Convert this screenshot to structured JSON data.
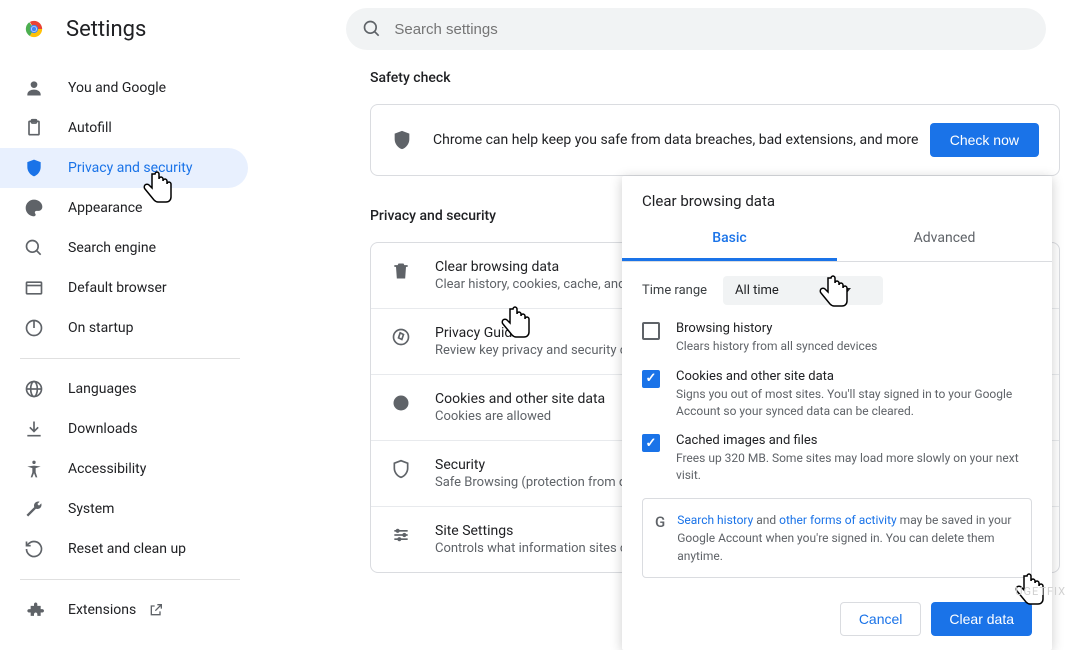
{
  "header": {
    "title": "Settings",
    "search_placeholder": "Search settings"
  },
  "sidebar": {
    "items": [
      {
        "label": "You and Google"
      },
      {
        "label": "Autofill"
      },
      {
        "label": "Privacy and security"
      },
      {
        "label": "Appearance"
      },
      {
        "label": "Search engine"
      },
      {
        "label": "Default browser"
      },
      {
        "label": "On startup"
      }
    ],
    "items2": [
      {
        "label": "Languages"
      },
      {
        "label": "Downloads"
      },
      {
        "label": "Accessibility"
      },
      {
        "label": "System"
      },
      {
        "label": "Reset and clean up"
      }
    ],
    "extensions_label": "Extensions"
  },
  "safety_check": {
    "title": "Safety check",
    "text": "Chrome can help keep you safe from data breaches, bad extensions, and more",
    "button": "Check now"
  },
  "privacy_section": {
    "title": "Privacy and security",
    "rows": [
      {
        "t1": "Clear browsing data",
        "t2": "Clear history, cookies, cache, and more"
      },
      {
        "t1": "Privacy Guide",
        "t2": "Review key privacy and security controls"
      },
      {
        "t1": "Cookies and other site data",
        "t2": "Cookies are allowed"
      },
      {
        "t1": "Security",
        "t2": "Safe Browsing (protection from dangerous sites) and other security settings"
      },
      {
        "t1": "Site Settings",
        "t2": "Controls what information sites can use and show"
      }
    ]
  },
  "dialog": {
    "title": "Clear browsing data",
    "tab_basic": "Basic",
    "tab_advanced": "Advanced",
    "time_label": "Time range",
    "time_value": "All time",
    "options": [
      {
        "t1": "Browsing history",
        "t2": "Clears history from all synced devices",
        "checked": false
      },
      {
        "t1": "Cookies and other site data",
        "t2": "Signs you out of most sites. You'll stay signed in to your Google Account so your synced data can be cleared.",
        "checked": true
      },
      {
        "t1": "Cached images and files",
        "t2": "Frees up 320 MB. Some sites may load more slowly on your next visit.",
        "checked": true
      }
    ],
    "info_link1": "Search history",
    "info_mid": " and ",
    "info_link2": "other forms of activity",
    "info_rest": " may be saved in your Google Account when you're signed in. You can delete them anytime.",
    "cancel": "Cancel",
    "clear": "Clear data"
  },
  "watermark": "UGETFIX"
}
